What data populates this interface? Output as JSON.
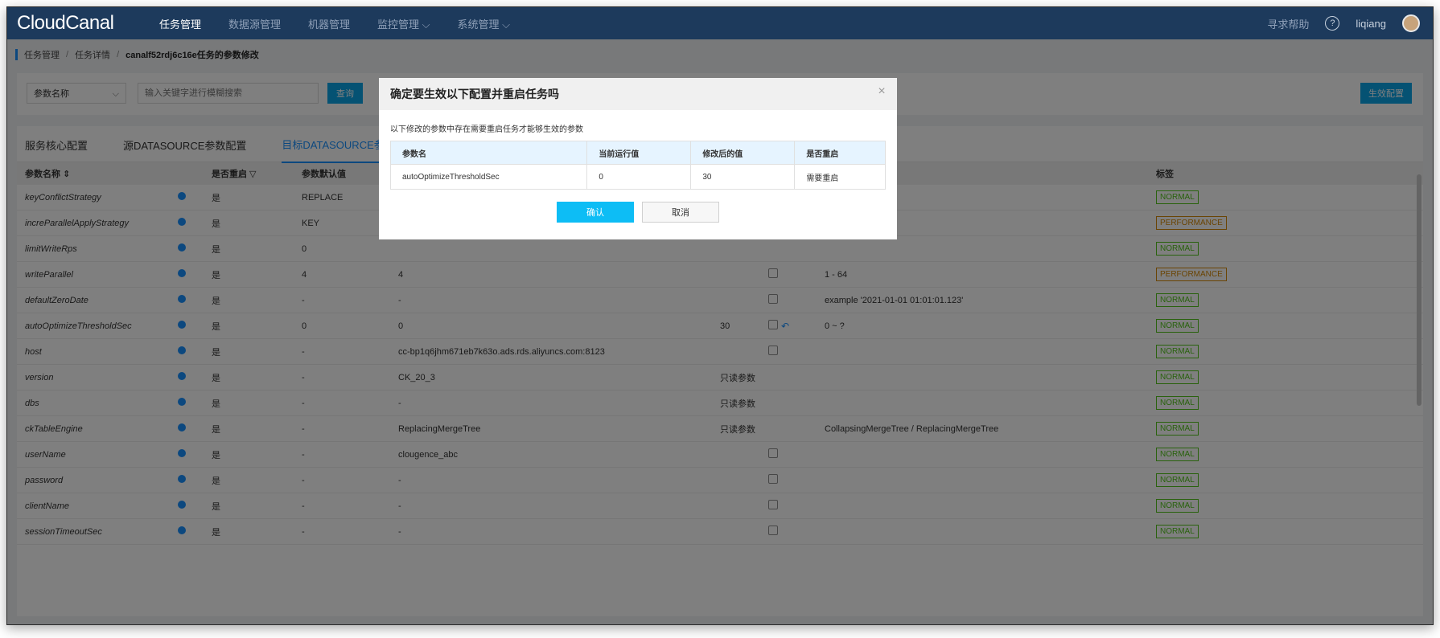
{
  "header": {
    "logo": "CloudCanal",
    "nav": [
      "任务管理",
      "数据源管理",
      "机器管理",
      "监控管理 ⌵",
      "系统管理 ⌵"
    ],
    "help": "寻求帮助",
    "help_icon": "?",
    "user": "liqiang"
  },
  "breadcrumb": {
    "items": [
      "任务管理",
      "任务详情"
    ],
    "separator": "/",
    "current": "canalf52rdj6c16e任务的参数修改"
  },
  "filter": {
    "select_value": "参数名称",
    "select_chevron": "⌵",
    "search_placeholder": "输入关键字进行模糊搜索",
    "query_button": "查询",
    "apply_button": "生效配置"
  },
  "tabs": [
    "服务核心配置",
    "源DATASOURCE参数配置",
    "目标DATASOURCE参数配置"
  ],
  "table": {
    "headers": [
      "参数名称 ⇕",
      "",
      "是否重启 ▽",
      "参数默认值",
      "",
      "",
      "",
      "",
      "标签"
    ],
    "rows": [
      {
        "name": "keyConflictStrategy",
        "restart": "是",
        "default": "REPLACE",
        "current": "",
        "modified": "",
        "editable": false,
        "range": "",
        "tag": "NORMAL"
      },
      {
        "name": "increParallelApplyStrategy",
        "restart": "是",
        "default": "KEY",
        "current": "",
        "modified": "",
        "editable": false,
        "range": "",
        "tag": "PERFORMANCE"
      },
      {
        "name": "limitWriteRps",
        "restart": "是",
        "default": "0",
        "current": "",
        "modified": "",
        "editable": false,
        "range": "",
        "tag": "NORMAL"
      },
      {
        "name": "writeParallel",
        "restart": "是",
        "default": "4",
        "current": "4",
        "modified": "",
        "editable": true,
        "range": "1 - 64",
        "tag": "PERFORMANCE"
      },
      {
        "name": "defaultZeroDate",
        "restart": "是",
        "default": "-",
        "current": "-",
        "modified": "",
        "editable": true,
        "range": "example '2021-01-01 01:01:01.123'",
        "tag": "NORMAL"
      },
      {
        "name": "autoOptimizeThresholdSec",
        "restart": "是",
        "default": "0",
        "current": "0",
        "modified": "30",
        "editable": true,
        "undo": true,
        "range": "0 ~ ?",
        "tag": "NORMAL"
      },
      {
        "name": "host",
        "restart": "是",
        "default": "-",
        "current": "cc-bp1q6jhm671eb7k63o.ads.rds.aliyuncs.com:8123",
        "modified": "",
        "editable": true,
        "range": "",
        "tag": "NORMAL"
      },
      {
        "name": "version",
        "restart": "是",
        "default": "-",
        "current": "CK_20_3",
        "modified": "只读参数",
        "editable": false,
        "range": "",
        "tag": "NORMAL"
      },
      {
        "name": "dbs",
        "restart": "是",
        "default": "-",
        "current": "-",
        "modified": "只读参数",
        "editable": false,
        "range": "",
        "tag": "NORMAL"
      },
      {
        "name": "ckTableEngine",
        "restart": "是",
        "default": "-",
        "current": "ReplacingMergeTree",
        "modified": "只读参数",
        "editable": false,
        "range": "CollapsingMergeTree / ReplacingMergeTree",
        "tag": "NORMAL"
      },
      {
        "name": "userName",
        "restart": "是",
        "default": "-",
        "current": "clougence_abc",
        "modified": "",
        "editable": true,
        "range": "",
        "tag": "NORMAL"
      },
      {
        "name": "password",
        "restart": "是",
        "default": "-",
        "current": "-",
        "modified": "",
        "editable": true,
        "range": "",
        "tag": "NORMAL"
      },
      {
        "name": "clientName",
        "restart": "是",
        "default": "-",
        "current": "-",
        "modified": "",
        "editable": true,
        "range": "",
        "tag": "NORMAL"
      },
      {
        "name": "sessionTimeoutSec",
        "restart": "是",
        "default": "-",
        "current": "-",
        "modified": "",
        "editable": true,
        "range": "",
        "tag": "NORMAL"
      }
    ]
  },
  "modal": {
    "title": "确定要生效以下配置并重启任务吗",
    "close": "×",
    "description": "以下修改的参数中存在需要重启任务才能够生效的参数",
    "headers": [
      "参数名",
      "当前运行值",
      "修改后的值",
      "是否重启"
    ],
    "rows": [
      [
        "autoOptimizeThresholdSec",
        "0",
        "30",
        "需要重启"
      ]
    ],
    "confirm": "确认",
    "cancel": "取消"
  },
  "colors": {
    "topbar": "#1d3a5c",
    "primary": "#0aa4e6",
    "tag_normal": "#52c41a",
    "tag_performance": "#d48806"
  }
}
